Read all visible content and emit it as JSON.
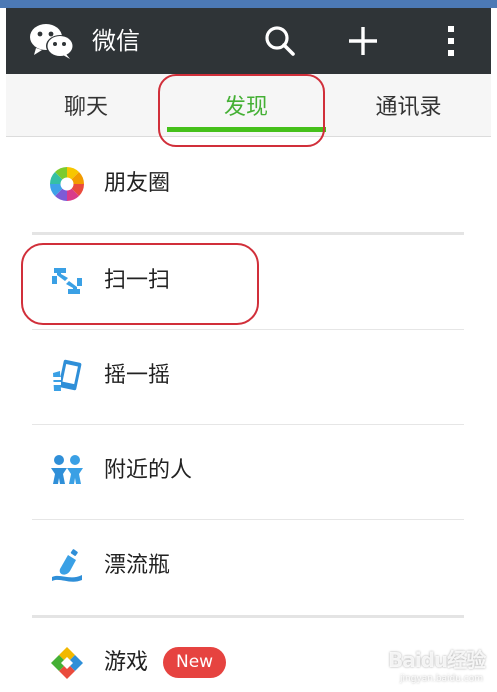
{
  "app": {
    "title": "微信",
    "header_color": "#2f3437",
    "accent_color": "#45c01a"
  },
  "toolbar": {
    "icons": [
      "wechat-logo-icon",
      "search-icon",
      "plus-icon",
      "more-vertical-icon"
    ]
  },
  "tabs": [
    {
      "label": "聊天",
      "selected": false
    },
    {
      "label": "发现",
      "selected": true
    },
    {
      "label": "通讯录",
      "selected": false
    }
  ],
  "discover": {
    "items": [
      {
        "label": "朋友圈",
        "icon": "moments-icon"
      },
      {
        "label": "扫一扫",
        "icon": "scan-icon"
      },
      {
        "label": "摇一摇",
        "icon": "shake-icon"
      },
      {
        "label": "附近的人",
        "icon": "people-nearby-icon"
      },
      {
        "label": "漂流瓶",
        "icon": "drift-bottle-icon"
      },
      {
        "label": "游戏",
        "icon": "games-icon",
        "badge": "New"
      }
    ]
  },
  "watermark": {
    "text": "Baidu经验",
    "sub": "jingyan.baidu.com"
  }
}
